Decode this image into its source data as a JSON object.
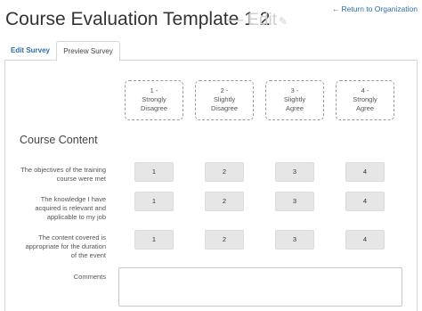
{
  "header": {
    "title": "Course Evaluation Template 1 2",
    "edit_label": "— Edit",
    "edit_icon": "pencil-icon",
    "return_label": "Return to Organization",
    "return_icon": "arrow-left-icon"
  },
  "tabs": [
    {
      "label": "Edit Survey",
      "active": false
    },
    {
      "label": "Preview Survey",
      "active": true
    }
  ],
  "scale": [
    {
      "number": "1 -",
      "line1": "Strongly",
      "line2": "Disagree"
    },
    {
      "number": "2 -",
      "line1": "Slightly",
      "line2": "Disagree"
    },
    {
      "number": "3 -",
      "line1": "Slightly",
      "line2": "Agree"
    },
    {
      "number": "4 -",
      "line1": "Strongly",
      "line2": "Agree"
    }
  ],
  "section": {
    "title": "Course Content"
  },
  "questions": [
    {
      "line1": "The objectives of the training",
      "line2": "course were met",
      "line3": ""
    },
    {
      "line1": "The knowledge I have",
      "line2": "acquired is relevant and",
      "line3": "applicable to my job"
    },
    {
      "line1": "The content covered is",
      "line2": "appropriate for the duration",
      "line3": "of the event"
    }
  ],
  "ratings": [
    "1",
    "2",
    "3",
    "4"
  ],
  "comments": {
    "label": "Comments",
    "value": ""
  },
  "colors": {
    "link": "#2f6fae",
    "button_bg": "#e6e6e6",
    "edit_muted": "#cfcfcf"
  }
}
